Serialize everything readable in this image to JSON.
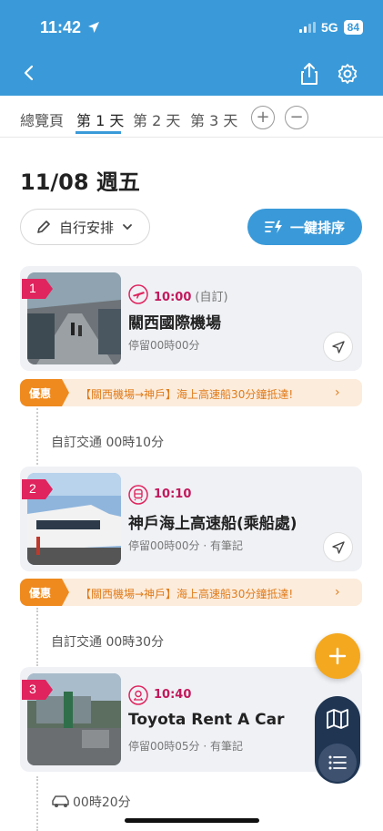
{
  "status": {
    "time": "11:42",
    "network": "5G",
    "battery": "84"
  },
  "tabs": [
    {
      "label": "總覽頁",
      "active": false
    },
    {
      "label": "第 1 天",
      "active": true
    },
    {
      "label": "第 2 天",
      "active": false
    },
    {
      "label": "第 3 天",
      "active": false
    }
  ],
  "day": {
    "date": "11/08 週五"
  },
  "actions": {
    "arrange_label": "自行安排",
    "sort_label": "一鍵排序"
  },
  "stops": [
    {
      "number": "1",
      "time": "10:00",
      "time_note": "(自訂)",
      "name": "關西國際機場",
      "stay": "停留00時00分"
    },
    {
      "number": "2",
      "time": "10:10",
      "time_note": "",
      "name": "神戶海上高速船(乘船處)",
      "stay": "停留00時00分 · 有筆記"
    },
    {
      "number": "3",
      "time": "10:40",
      "time_note": "",
      "name": "Toyota Rent A Car",
      "stay": "停留00時05分 · 有筆記"
    }
  ],
  "promos": [
    {
      "tag": "優惠",
      "text": "【關西機場→神戶】海上高速船30分鐘抵達!"
    },
    {
      "tag": "優惠",
      "text": "【關西機場→神戶】海上高速船30分鐘抵達!"
    }
  ],
  "transits": [
    {
      "text": "自訂交通 00時10分"
    },
    {
      "text": "自訂交通 00時30分"
    },
    {
      "text": "00時20分"
    }
  ],
  "colors": {
    "primary": "#3a9ad9",
    "accent_red": "#e0245e",
    "promo_orange": "#ef8a1f",
    "fab_yellow": "#f4a81f",
    "fab_navy": "#1f3552"
  }
}
